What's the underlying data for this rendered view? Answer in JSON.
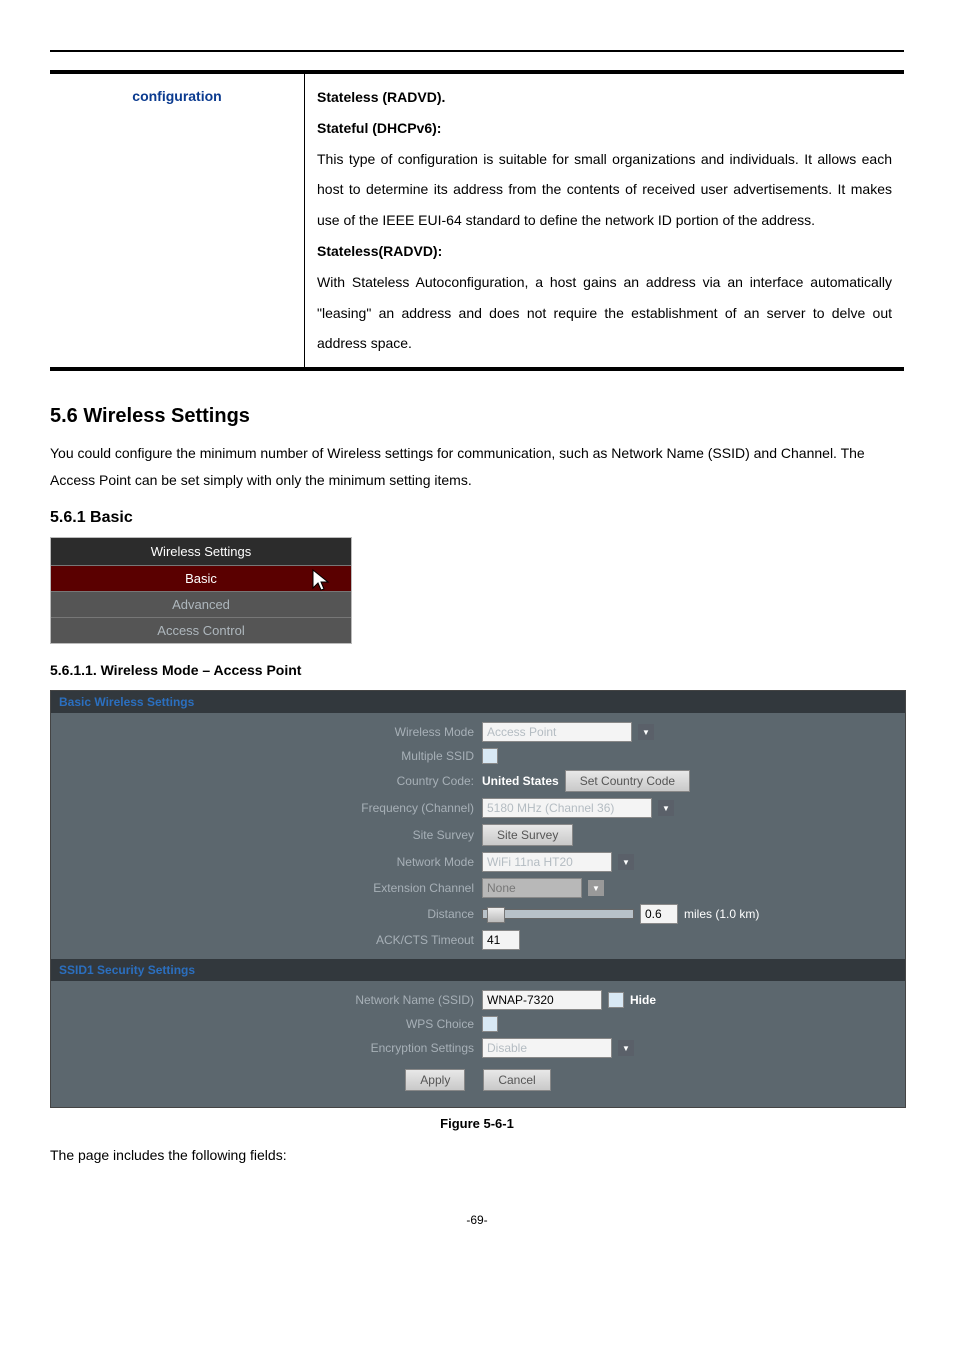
{
  "config_row": {
    "label": "configuration",
    "line1": "Stateless (RADVD).",
    "head2": "Stateful (DHCPv6):",
    "para2a": "This type of configuration is suitable for small organizations and individuals. It allows each host to determine its address from the contents of received user advertisements. It makes use of the IEEE EUI-64 standard to define the network ID portion of the address.",
    "head3": "Stateless(RADVD):",
    "para3a": "With Stateless Autoconfiguration, a host gains an address via an interface automatically \"leasing\" an address and does not require the establishment of an server to delve out address space."
  },
  "section": {
    "h2": "5.6  Wireless Settings",
    "intro": "You could configure the minimum number of Wireless settings for communication, such as Network Name (SSID) and Channel. The Access Point can be set simply with only the minimum setting items.",
    "h3": "5.6.1  Basic",
    "h4": "5.6.1.1.  Wireless Mode – Access Point"
  },
  "menu": {
    "header": "Wireless Settings",
    "items": [
      "Basic",
      "Advanced",
      "Access Control"
    ]
  },
  "panel": {
    "header1": "Basic Wireless Settings",
    "header2": "SSID1 Security Settings",
    "labels": {
      "wireless_mode": "Wireless Mode",
      "multiple_ssid": "Multiple SSID",
      "country_code": "Country Code:",
      "frequency": "Frequency (Channel)",
      "site_survey": "Site Survey",
      "network_mode": "Network Mode",
      "ext_channel": "Extension Channel",
      "distance": "Distance",
      "ack": "ACK/CTS Timeout",
      "ssid_name": "Network Name (SSID)",
      "wps": "WPS Choice",
      "encryption": "Encryption Settings"
    },
    "values": {
      "wireless_mode": "Access Point",
      "country_code_val": "United States",
      "country_code_btn": "Set Country Code",
      "frequency": "5180 MHz (Channel 36)",
      "site_survey_btn": "Site Survey",
      "network_mode": "WiFi 11na HT20",
      "ext_channel": "None",
      "distance_num": "0.6",
      "distance_unit": "miles (1.0 km)",
      "ack": "41",
      "ssid_name": "WNAP-7320",
      "hide_label": "Hide",
      "encryption": "Disable",
      "apply": "Apply",
      "cancel": "Cancel"
    }
  },
  "figure_caption": "Figure 5-6-1",
  "footer_text": "The page includes the following fields:",
  "page_num": "-69-"
}
